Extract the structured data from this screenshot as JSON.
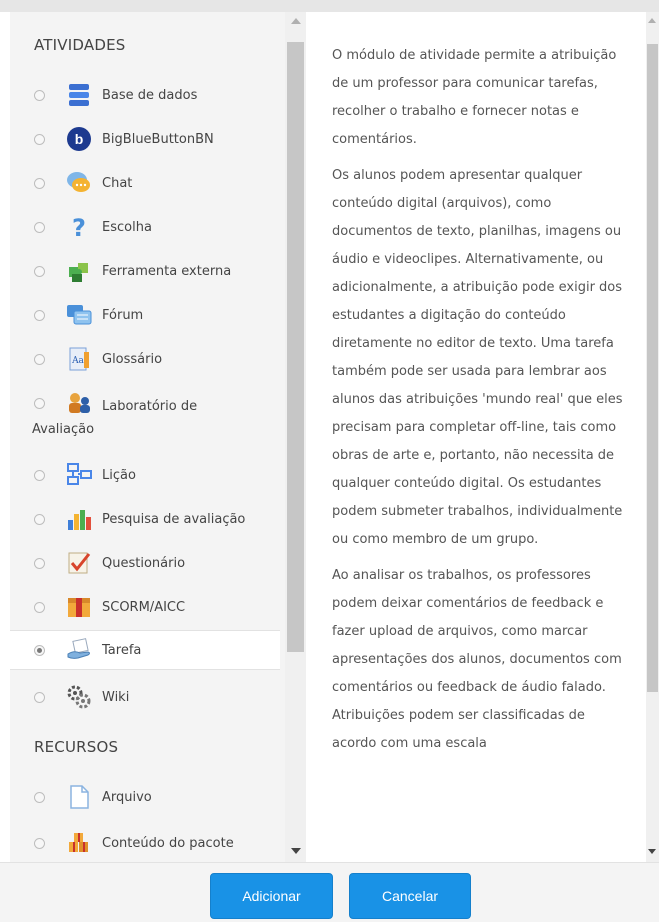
{
  "sections": {
    "activities_title": "ATIVIDADES",
    "resources_title": "RECURSOS"
  },
  "activities": [
    {
      "label": "Base de dados",
      "icon": "database-icon"
    },
    {
      "label": "BigBlueButtonBN",
      "icon": "bigbluebutton-icon"
    },
    {
      "label": "Chat",
      "icon": "chat-icon"
    },
    {
      "label": "Escolha",
      "icon": "question-mark-icon"
    },
    {
      "label": "Ferramenta externa",
      "icon": "puzzle-piece-icon"
    },
    {
      "label": "Fórum",
      "icon": "forum-icon"
    },
    {
      "label": "Glossário",
      "icon": "glossary-icon"
    },
    {
      "label": "Laboratório de",
      "label2": "Avaliação",
      "icon": "workshop-icon"
    },
    {
      "label": "Lição",
      "icon": "lesson-icon"
    },
    {
      "label": "Pesquisa de avaliação",
      "icon": "bar-chart-icon"
    },
    {
      "label": "Questionário",
      "icon": "quiz-checkmark-icon"
    },
    {
      "label": "SCORM/AICC",
      "icon": "scorm-package-icon"
    },
    {
      "label": "Tarefa",
      "icon": "assignment-hand-icon",
      "selected": true
    },
    {
      "label": "Wiki",
      "icon": "wiki-icon"
    }
  ],
  "resources": [
    {
      "label": "Arquivo",
      "icon": "file-icon"
    },
    {
      "label": "Conteúdo do pacote",
      "icon": "content-package-icon"
    }
  ],
  "help": {
    "paragraphs": [
      "O módulo de atividade permite a atribuição de um professor para comunicar tarefas, recolher o trabalho e fornecer notas e comentários.",
      "Os alunos podem apresentar qualquer conteúdo digital (arquivos), como documentos de texto, planilhas, imagens ou áudio e videoclipes. Alternativamente, ou adicionalmente, a atribuição pode exigir dos estudantes a digitação do conteúdo diretamente no editor de texto. Uma tarefa também pode ser usada para lembrar aos alunos das atribuições 'mundo real' que eles precisam para completar off-line, tais como obras de arte e, portanto, não necessita de qualquer conteúdo digital. Os estudantes podem submeter trabalhos, individualmente ou como membro de um grupo.",
      "Ao analisar os trabalhos, os professores podem deixar comentários de feedback e fazer upload de arquivos, como marcar apresentações dos alunos, documentos com comentários ou feedback de áudio falado. Atribuições podem ser classificadas de acordo com uma escala"
    ]
  },
  "footer": {
    "add_label": "Adicionar",
    "cancel_label": "Cancelar"
  },
  "colors": {
    "primary_button": "#1992e6",
    "panel_bg": "#f4f4f4"
  }
}
